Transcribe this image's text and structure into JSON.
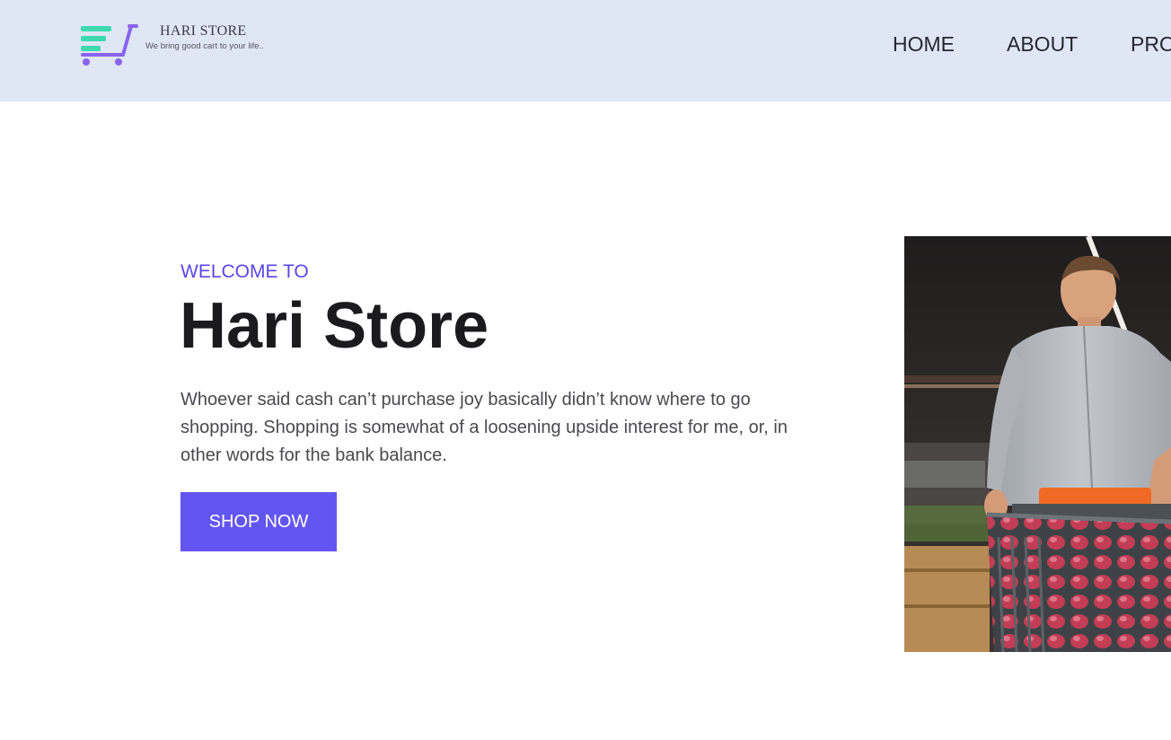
{
  "header": {
    "logo": {
      "title": "HARI STORE",
      "tagline": "We bring good cart to your life.."
    },
    "nav": [
      {
        "label": "HOME"
      },
      {
        "label": "ABOUT"
      },
      {
        "label": "PRO"
      }
    ]
  },
  "hero": {
    "subtitle": "WELCOME TO",
    "title": "Hari Store",
    "description": "Whoever said cash can’t purchase joy basically didn’t know where to go shopping. Shopping is somewhat of a loosening upside interest for me, or, in other words for the bank balance.",
    "cta_label": "SHOP NOW",
    "image": "man-pushing-shopping-cart-photo"
  },
  "colors": {
    "header_bg": "#dfe6f4",
    "accent": "#6355f2",
    "subtitle": "#5a46ee",
    "title": "#1b1b1e",
    "body_text": "#49494f",
    "logo_cart_green": "#3fd9b0",
    "logo_cart_purple": "#8a63f0"
  }
}
